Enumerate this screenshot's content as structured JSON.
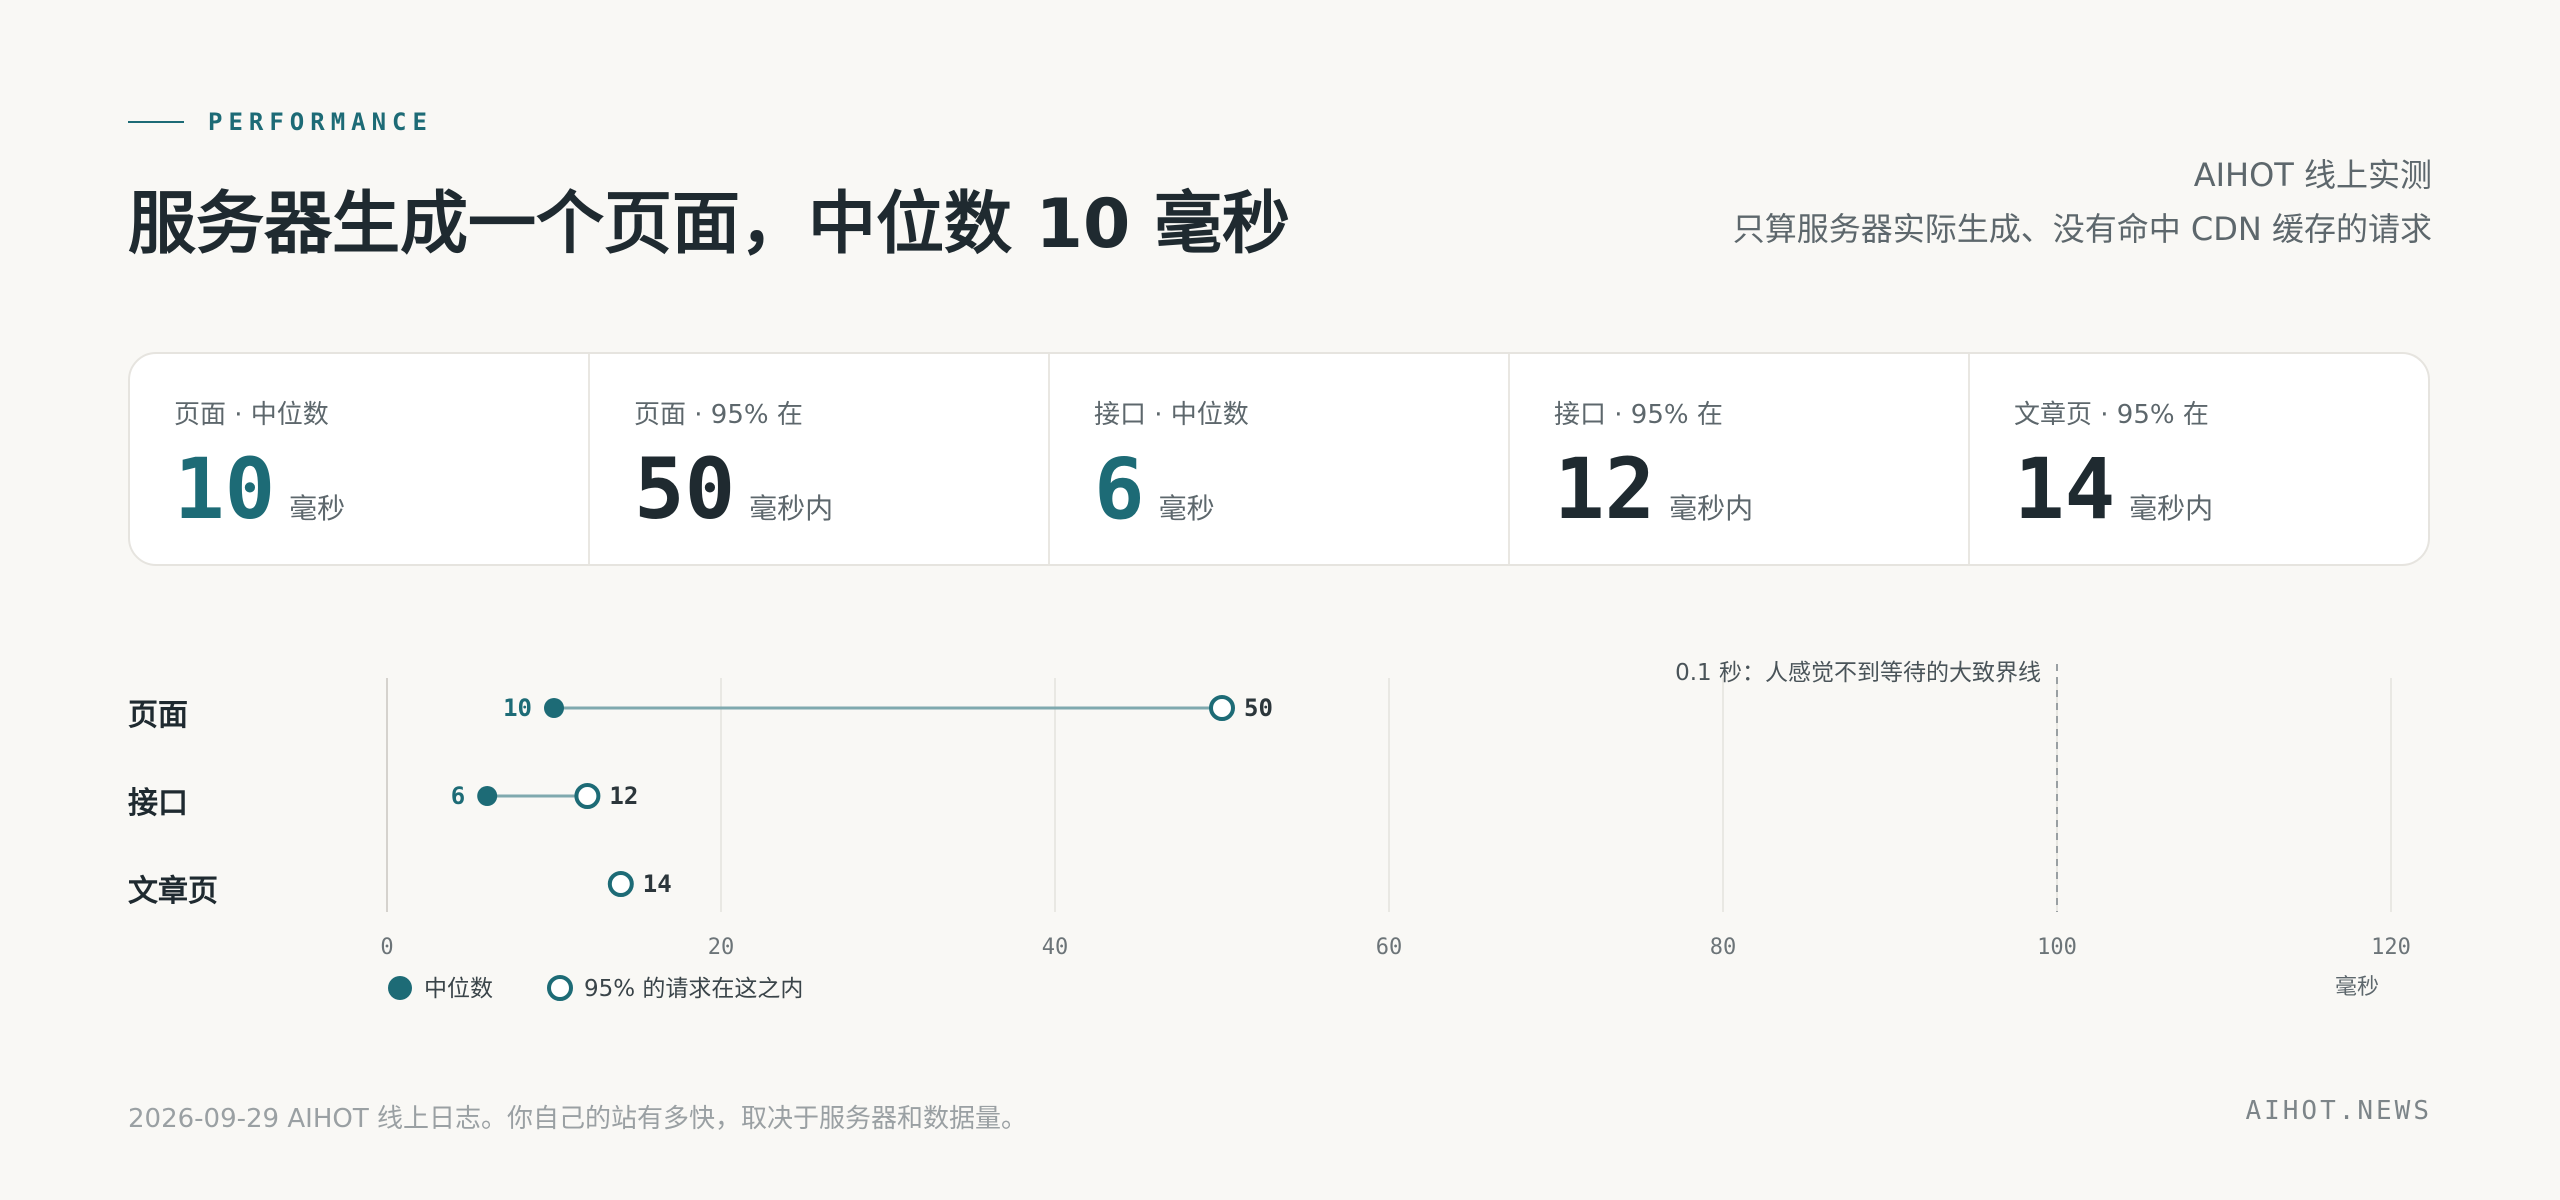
{
  "header": {
    "eyebrow": "PERFORMANCE",
    "title": "服务器生成一个页面，中位数 10 毫秒",
    "subtitle_line1": "AIHOT 线上实测",
    "subtitle_line2": "只算服务器实际生成、没有命中 CDN 缓存的请求"
  },
  "stats": [
    {
      "label": "页面 · 中位数",
      "value": "10",
      "unit": "毫秒",
      "accent": true
    },
    {
      "label": "页面 · 95% 在",
      "value": "50",
      "unit": "毫秒内",
      "accent": false
    },
    {
      "label": "接口 · 中位数",
      "value": "6",
      "unit": "毫秒",
      "accent": true
    },
    {
      "label": "接口 · 95% 在",
      "value": "12",
      "unit": "毫秒内",
      "accent": false
    },
    {
      "label": "文章页 · 95% 在",
      "value": "14",
      "unit": "毫秒内",
      "accent": false
    }
  ],
  "chart_data": {
    "type": "dumbbell",
    "categories": [
      "页面",
      "接口",
      "文章页"
    ],
    "series": [
      {
        "name": "中位数",
        "values": [
          10,
          6,
          null
        ]
      },
      {
        "name": "95% 的请求在这之内",
        "values": [
          50,
          12,
          14
        ]
      }
    ],
    "xlim": [
      0,
      120
    ],
    "xticks": [
      0,
      20,
      40,
      60,
      80,
      100,
      120
    ],
    "xlabel": "毫秒",
    "reference_line": {
      "value": 100,
      "label": "0.1 秒：人感觉不到等待的大致界线"
    },
    "legend_placement": "bottom-left",
    "grid": true,
    "colors": {
      "accent": "#1d6b76",
      "connector": "#7fa9ae",
      "grid": "#e4e2dd",
      "reference": "#9aa0a3"
    }
  },
  "footer": {
    "note": "2026-09-29 AIHOT 线上日志。你自己的站有多快，取决于服务器和数据量。",
    "brand": "AIHOT.NEWS"
  }
}
